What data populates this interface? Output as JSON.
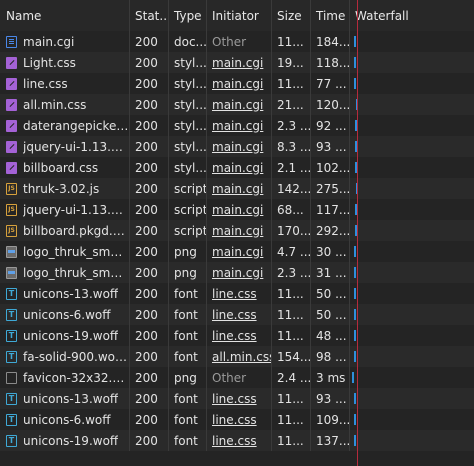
{
  "columns": {
    "name": "Name",
    "status": "Stat...",
    "type": "Type",
    "initiator": "Initiator",
    "size": "Size",
    "time": "Time",
    "waterfall": "Waterfall"
  },
  "colors": {
    "background": "#242424",
    "waterfall_bar": "#2f8fdc",
    "load_line": "#b52a3c",
    "css_icon": "#a462d6",
    "js_icon": "#d7a13c",
    "font_icon": "#3fa9d6",
    "doc_icon": "#4a87e8"
  },
  "rows": [
    {
      "icon": "document-icon",
      "name": "main.cgi",
      "status": "200",
      "type": "doc...",
      "initiator": "Other",
      "initiator_link": false,
      "size": "11...",
      "time": "184..."
    },
    {
      "icon": "stylesheet-icon",
      "name": "Light.css",
      "status": "200",
      "type": "styl...",
      "initiator": "main.cgi",
      "initiator_link": true,
      "size": "19...",
      "time": "118..."
    },
    {
      "icon": "stylesheet-icon",
      "name": "line.css",
      "status": "200",
      "type": "styl...",
      "initiator": "main.cgi",
      "initiator_link": true,
      "size": "11...",
      "time": "77 ..."
    },
    {
      "icon": "stylesheet-icon",
      "name": "all.min.css",
      "status": "200",
      "type": "styl...",
      "initiator": "main.cgi",
      "initiator_link": true,
      "size": "21...",
      "time": "120..."
    },
    {
      "icon": "stylesheet-icon",
      "name": "daterangepicker....",
      "status": "200",
      "type": "styl...",
      "initiator": "main.cgi",
      "initiator_link": true,
      "size": "2.3 ...",
      "time": "92 ..."
    },
    {
      "icon": "stylesheet-icon",
      "name": "jquery-ui-1.13.1.c...",
      "status": "200",
      "type": "styl...",
      "initiator": "main.cgi",
      "initiator_link": true,
      "size": "8.3 ...",
      "time": "93 ..."
    },
    {
      "icon": "stylesheet-icon",
      "name": "billboard.css",
      "status": "200",
      "type": "styl...",
      "initiator": "main.cgi",
      "initiator_link": true,
      "size": "2.1 ...",
      "time": "102..."
    },
    {
      "icon": "script-icon",
      "name": "thruk-3.02.js",
      "status": "200",
      "type": "script",
      "initiator": "main.cgi",
      "initiator_link": true,
      "size": "142...",
      "time": "275..."
    },
    {
      "icon": "script-icon",
      "name": "jquery-ui-1.13.1.c...",
      "status": "200",
      "type": "script",
      "initiator": "main.cgi",
      "initiator_link": true,
      "size": "68...",
      "time": "117..."
    },
    {
      "icon": "script-icon",
      "name": "billboard.pkgd.m...",
      "status": "200",
      "type": "script",
      "initiator": "main.cgi",
      "initiator_link": true,
      "size": "170...",
      "time": "292..."
    },
    {
      "icon": "image-icon",
      "name": "logo_thruk_small...",
      "status": "200",
      "type": "png",
      "initiator": "main.cgi",
      "initiator_link": true,
      "size": "4.7 ...",
      "time": "30 ..."
    },
    {
      "icon": "image-icon",
      "name": "logo_thruk_small...",
      "status": "200",
      "type": "png",
      "initiator": "main.cgi",
      "initiator_link": true,
      "size": "2.3 ...",
      "time": "31 ..."
    },
    {
      "icon": "font-icon",
      "name": "unicons-13.woff",
      "status": "200",
      "type": "font",
      "initiator": "line.css",
      "initiator_link": true,
      "size": "11...",
      "time": "50 ..."
    },
    {
      "icon": "font-icon",
      "name": "unicons-6.woff",
      "status": "200",
      "type": "font",
      "initiator": "line.css",
      "initiator_link": true,
      "size": "11...",
      "time": "50 ..."
    },
    {
      "icon": "font-icon",
      "name": "unicons-19.woff",
      "status": "200",
      "type": "font",
      "initiator": "line.css",
      "initiator_link": true,
      "size": "11...",
      "time": "48 ..."
    },
    {
      "icon": "font-icon",
      "name": "fa-solid-900.woff2",
      "status": "200",
      "type": "font",
      "initiator": "all.min.css",
      "initiator_link": true,
      "size": "154...",
      "time": "98 ..."
    },
    {
      "icon": "blank-file-icon",
      "name": "favicon-32x32.png",
      "status": "200",
      "type": "png",
      "initiator": "Other",
      "initiator_link": false,
      "size": "2.4 ...",
      "time": "3 ms"
    },
    {
      "icon": "font-icon",
      "name": "unicons-13.woff",
      "status": "200",
      "type": "font",
      "initiator": "line.css",
      "initiator_link": true,
      "size": "11...",
      "time": "93 ..."
    },
    {
      "icon": "font-icon",
      "name": "unicons-6.woff",
      "status": "200",
      "type": "font",
      "initiator": "line.css",
      "initiator_link": true,
      "size": "11...",
      "time": "109..."
    },
    {
      "icon": "font-icon",
      "name": "unicons-19.woff",
      "status": "200",
      "type": "font",
      "initiator": "line.css",
      "initiator_link": true,
      "size": "11...",
      "time": "137..."
    }
  ]
}
